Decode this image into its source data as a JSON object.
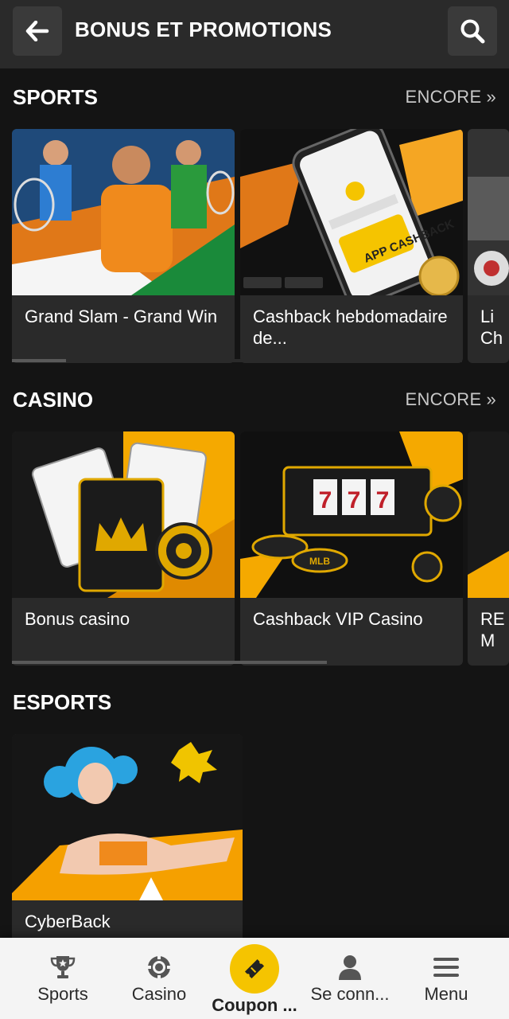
{
  "header": {
    "title": "BONUS ET PROMOTIONS"
  },
  "sections": {
    "sports": {
      "title": "SPORTS",
      "more": "ENCORE",
      "cards": [
        {
          "title": "Grand Slam - Grand Win"
        },
        {
          "title": "Cashback hebdomadaire de..."
        },
        {
          "title": "Li\nCh"
        }
      ],
      "card2_image_text": "APP CASHBACK",
      "scroll_progress": 0.12
    },
    "casino": {
      "title": "CASINO",
      "more": "ENCORE",
      "cards": [
        {
          "title": "Bonus casino"
        },
        {
          "title": "Cashback VIP Casino"
        },
        {
          "title": "RE\nM"
        }
      ],
      "slot_digits": [
        "7",
        "7",
        "7"
      ],
      "chip_text": "MLB",
      "scroll_progress": 0.7
    },
    "esports": {
      "title": "ESPORTS",
      "cards": [
        {
          "title": "CyberBack"
        }
      ]
    }
  },
  "bottom_nav": [
    {
      "label": "Sports",
      "icon": "trophy-icon"
    },
    {
      "label": "Casino",
      "icon": "casino-chip-icon"
    },
    {
      "label": "Coupon ...",
      "icon": "ticket-icon"
    },
    {
      "label": "Se conn...",
      "icon": "user-icon"
    },
    {
      "label": "Menu",
      "icon": "menu-icon"
    }
  ],
  "colors": {
    "accent": "#f5c400",
    "orange": "#f08a1c",
    "background": "#141414",
    "card": "#2a2a2a",
    "header": "#2a2a2a"
  }
}
